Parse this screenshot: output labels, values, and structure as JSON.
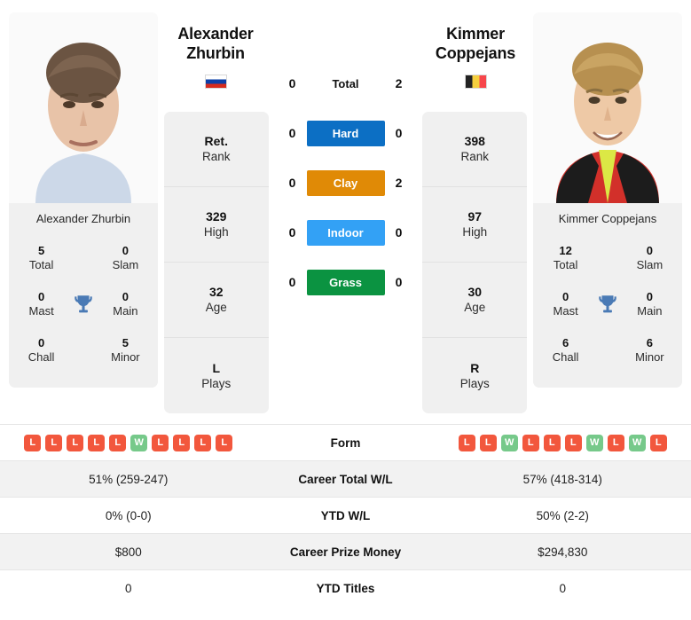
{
  "players": {
    "left": {
      "first_name": "Alexander",
      "last_name": "Zhurbin",
      "full_name": "Alexander Zhurbin",
      "country_flag": "flag-russia",
      "rank": "Ret.",
      "rank_label": "Rank",
      "high": "329",
      "high_label": "High",
      "age": "32",
      "age_label": "Age",
      "plays": "L",
      "plays_label": "Plays",
      "titles": {
        "total": "5",
        "total_label": "Total",
        "slam": "0",
        "slam_label": "Slam",
        "mast": "0",
        "mast_label": "Mast",
        "main": "0",
        "main_label": "Main",
        "chall": "0",
        "chall_label": "Chall",
        "minor": "5",
        "minor_label": "Minor"
      },
      "form": [
        "L",
        "L",
        "L",
        "L",
        "L",
        "W",
        "L",
        "L",
        "L",
        "L"
      ],
      "career_total_wl": "51% (259-247)",
      "ytd_wl": "0% (0-0)",
      "career_prize_money": "$800",
      "ytd_titles": "0"
    },
    "right": {
      "first_name": "Kimmer",
      "last_name": "Coppejans",
      "full_name": "Kimmer Coppejans",
      "country_flag": "flag-belgium",
      "rank": "398",
      "rank_label": "Rank",
      "high": "97",
      "high_label": "High",
      "age": "30",
      "age_label": "Age",
      "plays": "R",
      "plays_label": "Plays",
      "titles": {
        "total": "12",
        "total_label": "Total",
        "slam": "0",
        "slam_label": "Slam",
        "mast": "0",
        "mast_label": "Mast",
        "main": "0",
        "main_label": "Main",
        "chall": "6",
        "chall_label": "Chall",
        "minor": "6",
        "minor_label": "Minor"
      },
      "form": [
        "L",
        "L",
        "W",
        "L",
        "L",
        "L",
        "W",
        "L",
        "W",
        "L"
      ],
      "career_total_wl": "57% (418-314)",
      "ytd_wl": "50% (2-2)",
      "career_prize_money": "$294,830",
      "ytd_titles": "0"
    }
  },
  "head_to_head": {
    "rows": [
      {
        "label": "Total",
        "left": "0",
        "right": "2",
        "style": "plain",
        "color": ""
      },
      {
        "label": "Hard",
        "left": "0",
        "right": "0",
        "style": "hard",
        "color": "#0c6fc4"
      },
      {
        "label": "Clay",
        "left": "0",
        "right": "2",
        "style": "clay",
        "color": "#e08a06"
      },
      {
        "label": "Indoor",
        "left": "0",
        "right": "0",
        "style": "indoor",
        "color": "#33a1f5"
      },
      {
        "label": "Grass",
        "left": "0",
        "right": "0",
        "style": "grass",
        "color": "#0b9341"
      }
    ]
  },
  "comparison_table": {
    "rows": [
      {
        "label": "Form",
        "type": "form"
      },
      {
        "label": "Career Total W/L",
        "type": "text",
        "key": "career_total_wl"
      },
      {
        "label": "YTD W/L",
        "type": "text",
        "key": "ytd_wl"
      },
      {
        "label": "Career Prize Money",
        "type": "text",
        "key": "career_prize_money"
      },
      {
        "label": "YTD Titles",
        "type": "text",
        "key": "ytd_titles"
      }
    ]
  },
  "colors": {
    "win": "#76c98a",
    "loss": "#f2573d",
    "trophy": "#4a7ab5",
    "card_bg": "#f0f0f0",
    "row_shade": "#f2f2f2"
  }
}
